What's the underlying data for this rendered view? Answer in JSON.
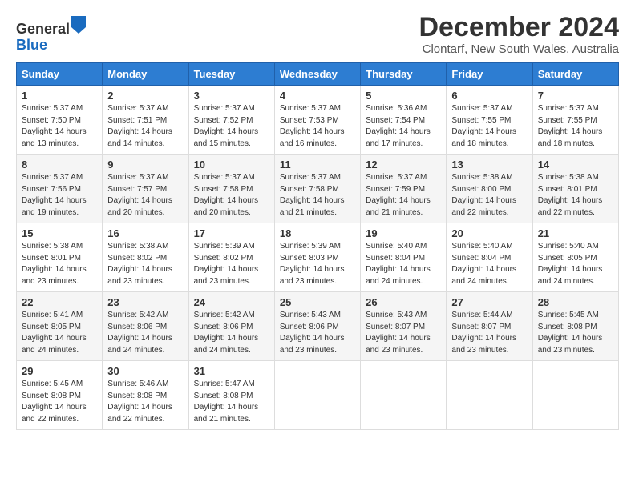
{
  "header": {
    "logo_line1": "General",
    "logo_line2": "Blue",
    "title": "December 2024",
    "subtitle": "Clontarf, New South Wales, Australia"
  },
  "weekdays": [
    "Sunday",
    "Monday",
    "Tuesday",
    "Wednesday",
    "Thursday",
    "Friday",
    "Saturday"
  ],
  "weeks": [
    [
      {
        "day": "1",
        "info": "Sunrise: 5:37 AM\nSunset: 7:50 PM\nDaylight: 14 hours\nand 13 minutes."
      },
      {
        "day": "2",
        "info": "Sunrise: 5:37 AM\nSunset: 7:51 PM\nDaylight: 14 hours\nand 14 minutes."
      },
      {
        "day": "3",
        "info": "Sunrise: 5:37 AM\nSunset: 7:52 PM\nDaylight: 14 hours\nand 15 minutes."
      },
      {
        "day": "4",
        "info": "Sunrise: 5:37 AM\nSunset: 7:53 PM\nDaylight: 14 hours\nand 16 minutes."
      },
      {
        "day": "5",
        "info": "Sunrise: 5:36 AM\nSunset: 7:54 PM\nDaylight: 14 hours\nand 17 minutes."
      },
      {
        "day": "6",
        "info": "Sunrise: 5:37 AM\nSunset: 7:55 PM\nDaylight: 14 hours\nand 18 minutes."
      },
      {
        "day": "7",
        "info": "Sunrise: 5:37 AM\nSunset: 7:55 PM\nDaylight: 14 hours\nand 18 minutes."
      }
    ],
    [
      {
        "day": "8",
        "info": "Sunrise: 5:37 AM\nSunset: 7:56 PM\nDaylight: 14 hours\nand 19 minutes."
      },
      {
        "day": "9",
        "info": "Sunrise: 5:37 AM\nSunset: 7:57 PM\nDaylight: 14 hours\nand 20 minutes."
      },
      {
        "day": "10",
        "info": "Sunrise: 5:37 AM\nSunset: 7:58 PM\nDaylight: 14 hours\nand 20 minutes."
      },
      {
        "day": "11",
        "info": "Sunrise: 5:37 AM\nSunset: 7:58 PM\nDaylight: 14 hours\nand 21 minutes."
      },
      {
        "day": "12",
        "info": "Sunrise: 5:37 AM\nSunset: 7:59 PM\nDaylight: 14 hours\nand 21 minutes."
      },
      {
        "day": "13",
        "info": "Sunrise: 5:38 AM\nSunset: 8:00 PM\nDaylight: 14 hours\nand 22 minutes."
      },
      {
        "day": "14",
        "info": "Sunrise: 5:38 AM\nSunset: 8:01 PM\nDaylight: 14 hours\nand 22 minutes."
      }
    ],
    [
      {
        "day": "15",
        "info": "Sunrise: 5:38 AM\nSunset: 8:01 PM\nDaylight: 14 hours\nand 23 minutes."
      },
      {
        "day": "16",
        "info": "Sunrise: 5:38 AM\nSunset: 8:02 PM\nDaylight: 14 hours\nand 23 minutes."
      },
      {
        "day": "17",
        "info": "Sunrise: 5:39 AM\nSunset: 8:02 PM\nDaylight: 14 hours\nand 23 minutes."
      },
      {
        "day": "18",
        "info": "Sunrise: 5:39 AM\nSunset: 8:03 PM\nDaylight: 14 hours\nand 23 minutes."
      },
      {
        "day": "19",
        "info": "Sunrise: 5:40 AM\nSunset: 8:04 PM\nDaylight: 14 hours\nand 24 minutes."
      },
      {
        "day": "20",
        "info": "Sunrise: 5:40 AM\nSunset: 8:04 PM\nDaylight: 14 hours\nand 24 minutes."
      },
      {
        "day": "21",
        "info": "Sunrise: 5:40 AM\nSunset: 8:05 PM\nDaylight: 14 hours\nand 24 minutes."
      }
    ],
    [
      {
        "day": "22",
        "info": "Sunrise: 5:41 AM\nSunset: 8:05 PM\nDaylight: 14 hours\nand 24 minutes."
      },
      {
        "day": "23",
        "info": "Sunrise: 5:42 AM\nSunset: 8:06 PM\nDaylight: 14 hours\nand 24 minutes."
      },
      {
        "day": "24",
        "info": "Sunrise: 5:42 AM\nSunset: 8:06 PM\nDaylight: 14 hours\nand 24 minutes."
      },
      {
        "day": "25",
        "info": "Sunrise: 5:43 AM\nSunset: 8:06 PM\nDaylight: 14 hours\nand 23 minutes."
      },
      {
        "day": "26",
        "info": "Sunrise: 5:43 AM\nSunset: 8:07 PM\nDaylight: 14 hours\nand 23 minutes."
      },
      {
        "day": "27",
        "info": "Sunrise: 5:44 AM\nSunset: 8:07 PM\nDaylight: 14 hours\nand 23 minutes."
      },
      {
        "day": "28",
        "info": "Sunrise: 5:45 AM\nSunset: 8:08 PM\nDaylight: 14 hours\nand 23 minutes."
      }
    ],
    [
      {
        "day": "29",
        "info": "Sunrise: 5:45 AM\nSunset: 8:08 PM\nDaylight: 14 hours\nand 22 minutes."
      },
      {
        "day": "30",
        "info": "Sunrise: 5:46 AM\nSunset: 8:08 PM\nDaylight: 14 hours\nand 22 minutes."
      },
      {
        "day": "31",
        "info": "Sunrise: 5:47 AM\nSunset: 8:08 PM\nDaylight: 14 hours\nand 21 minutes."
      },
      null,
      null,
      null,
      null
    ]
  ]
}
